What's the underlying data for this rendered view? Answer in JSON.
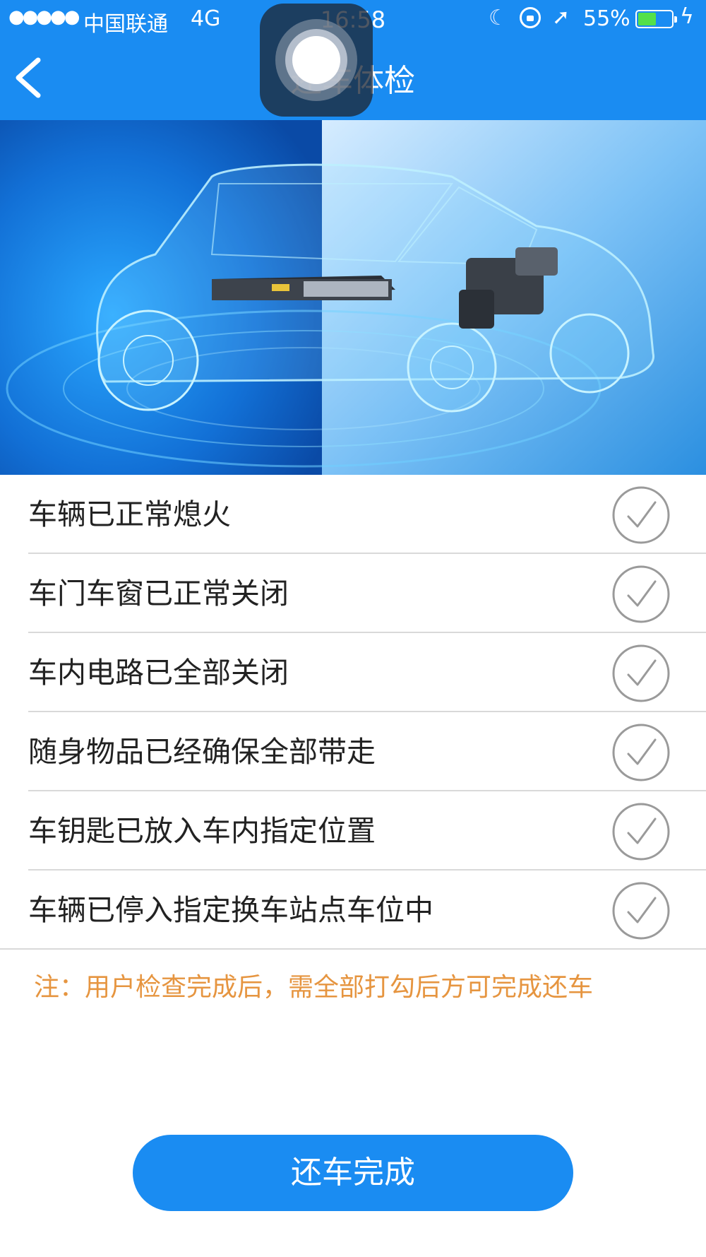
{
  "status_bar": {
    "signal": "●●●●●",
    "carrier": "中国联通",
    "network": "4G",
    "time": "16:58",
    "battery_percent": "55%",
    "battery_level": 0.55,
    "icons": [
      "moon-icon",
      "orientation-lock-icon",
      "location-arrow-icon",
      "battery-icon",
      "charging-bolt-icon"
    ]
  },
  "nav": {
    "title": "还车体检",
    "back_icon": "chevron-left-icon"
  },
  "assistive_touch_icon": "assistive-touch-icon",
  "hero_image": {
    "icon": "car-xray-illustration"
  },
  "checklist": {
    "items": [
      {
        "label": "车辆已正常熄火",
        "checked": false
      },
      {
        "label": "车门车窗已正常关闭",
        "checked": false
      },
      {
        "label": "车内电路已全部关闭",
        "checked": false
      },
      {
        "label": "随身物品已经确保全部带走",
        "checked": false
      },
      {
        "label": "车钥匙已放入车内指定位置",
        "checked": false
      },
      {
        "label": "车辆已停入指定换车站点车位中",
        "checked": false
      }
    ]
  },
  "note": "注：用户检查完成后，需全部打勾后方可完成还车",
  "done_button": {
    "label": "还车完成"
  },
  "colors": {
    "primary": "#1a8cf2",
    "note": "#e69540",
    "check_circle": "#9a9a9a",
    "battery_fill": "#54e04a"
  }
}
